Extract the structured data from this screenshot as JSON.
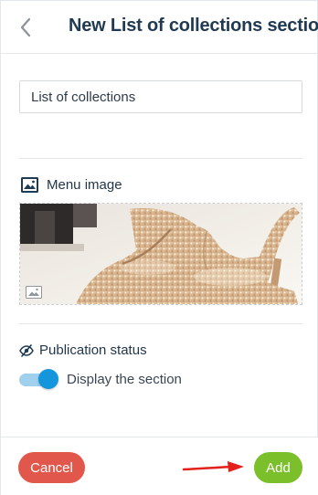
{
  "header": {
    "back_icon": "chevron-left-icon",
    "title": "New List of collections section"
  },
  "form": {
    "name_value": "List of collections",
    "menu_image": {
      "icon": "image-icon",
      "label": "Menu image",
      "placeholder_icon": "image-placeholder-icon"
    },
    "publication": {
      "icon": "eye-slash-icon",
      "label": "Publication status",
      "toggle_label": "Display the section",
      "toggle_on": true
    }
  },
  "footer": {
    "cancel_label": "Cancel",
    "add_label": "Add",
    "arrow_icon": "red-arrow-icon"
  },
  "colors": {
    "title": "#1f3a52",
    "cancel": "#e2574c",
    "add": "#7bbf2a",
    "toggle_knob": "#1596dc",
    "toggle_track": "#9fd0ee",
    "arrow": "#e3201b"
  }
}
